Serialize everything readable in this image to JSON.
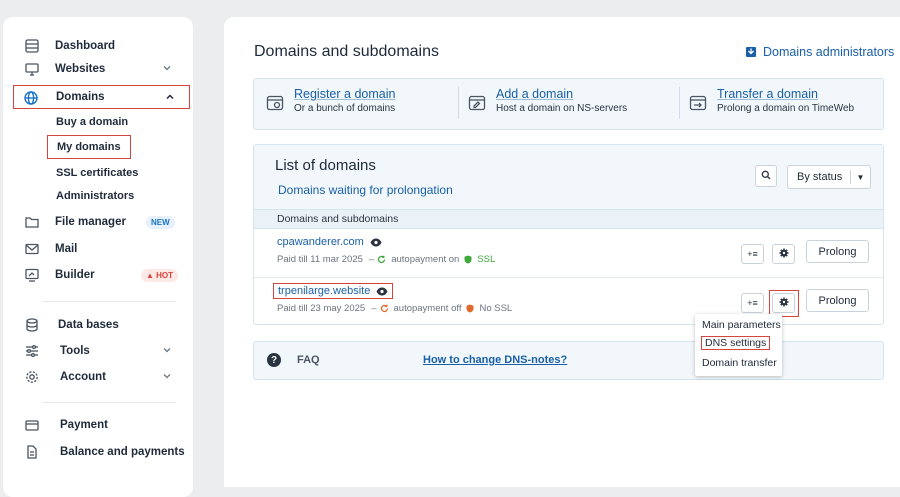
{
  "sidebar": {
    "items": [
      {
        "label": "Dashboard",
        "icon": "dashboard-icon"
      },
      {
        "label": "Websites",
        "icon": "monitor-icon"
      },
      {
        "label": "Domains",
        "icon": "globe-icon"
      },
      {
        "label": "File manager",
        "icon": "folder-icon",
        "badge": "NEW"
      },
      {
        "label": "Mail",
        "icon": "mail-icon"
      },
      {
        "label": "Builder",
        "icon": "builder-icon",
        "badge": "HOT"
      },
      {
        "label": "Data bases",
        "icon": "database-icon"
      },
      {
        "label": "Tools",
        "icon": "sliders-icon"
      },
      {
        "label": "Account",
        "icon": "gear-icon"
      },
      {
        "label": "Payment",
        "icon": "card-icon"
      },
      {
        "label": "Balance and payments",
        "icon": "document-icon"
      }
    ],
    "domains_sub": [
      "Buy a domain",
      "My domains",
      "SSL certificates",
      "Administrators"
    ]
  },
  "main": {
    "title": "Domains and subdomains",
    "admins_link": "Domains administrators",
    "actions": [
      {
        "title": "Register a domain",
        "subtitle": "Or a bunch of domains"
      },
      {
        "title": "Add a domain",
        "subtitle": "Host a domain on NS-servers"
      },
      {
        "title": "Transfer a domain",
        "subtitle": "Prolong a domain on TimeWeb"
      }
    ],
    "list": {
      "title": "List of domains",
      "waiting_link": "Domains waiting for prolongation",
      "status_select": "By status",
      "subheader": "Domains and subdomains",
      "rows": [
        {
          "name": "cpawanderer.com",
          "paid": "Paid till 11 mar 2025",
          "autopay": "autopayment on",
          "ssl": "SSL",
          "prolong": "Prolong"
        },
        {
          "name": "trpenilarge.website",
          "paid": "Paid till 23 may 2025",
          "autopay": "autopayment off",
          "ssl": "No SSL",
          "prolong": "Prolong"
        }
      ]
    },
    "dropdown": [
      "Main parameters",
      "DNS settings",
      "Domain transfer"
    ],
    "faq": {
      "label": "FAQ",
      "link": "How to change DNS-notes?"
    }
  },
  "colors": {
    "accent": "#1a5fa8",
    "highlight": "#d6453d",
    "ok": "#3fa83b",
    "warn": "#e06a2c"
  }
}
